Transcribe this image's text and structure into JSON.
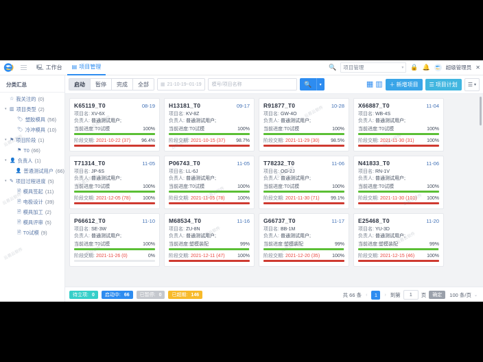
{
  "header": {
    "logo_icon": "brand-logo-icon",
    "menu_icon": "hamburger-icon",
    "tabs": [
      {
        "label": "工作台",
        "icon": "monitor-icon",
        "active": false
      },
      {
        "label": "项目管理",
        "icon": "grid-icon",
        "active": true
      }
    ],
    "search_icon": "search-icon",
    "module_select": "项目管理",
    "lock_icon": "lock-icon",
    "bell_icon": "bell-icon",
    "avatar_icon": "user-avatar",
    "username": "超级管理员",
    "close_icon": "close-icon"
  },
  "sidebar": {
    "title": "分类汇总",
    "items": [
      {
        "label": "我关注的",
        "count": "(0)",
        "icon": "star-icon",
        "level": 1,
        "caret": ""
      },
      {
        "label": "项目类型",
        "count": "(2)",
        "icon": "folder-icon",
        "level": 1,
        "caret": "▾"
      },
      {
        "label": "塑胶模具",
        "count": "(56)",
        "icon": "tag-icon",
        "level": 2,
        "caret": ""
      },
      {
        "label": "冷冲模具",
        "count": "(10)",
        "icon": "tag-icon",
        "level": 2,
        "caret": ""
      },
      {
        "label": "项目阶段",
        "count": "(1)",
        "icon": "flag-icon",
        "level": 1,
        "caret": "▾"
      },
      {
        "label": "T0",
        "count": "(66)",
        "icon": "flag-icon",
        "level": 2,
        "caret": ""
      },
      {
        "label": "负责人",
        "count": "(1)",
        "icon": "user-icon",
        "level": 1,
        "caret": "▾"
      },
      {
        "label": "普通测试用户",
        "count": "(66)",
        "icon": "user-icon",
        "level": 2,
        "caret": ""
      },
      {
        "label": "项目过程进度",
        "count": "(5)",
        "icon": "process-icon",
        "level": 1,
        "caret": "▾"
      },
      {
        "label": "模具签起",
        "count": "(11)",
        "icon": "file-icon",
        "level": 2,
        "caret": ""
      },
      {
        "label": "电极设计",
        "count": "(39)",
        "icon": "file-icon",
        "level": 2,
        "caret": ""
      },
      {
        "label": "模具加工",
        "count": "(2)",
        "icon": "file-icon",
        "level": 2,
        "caret": ""
      },
      {
        "label": "模具评审",
        "count": "(5)",
        "icon": "file-icon",
        "level": 2,
        "caret": ""
      },
      {
        "label": "T0试模",
        "count": "(9)",
        "icon": "file-icon",
        "level": 2,
        "caret": ""
      }
    ]
  },
  "toolbar": {
    "segments": [
      {
        "label": "启动",
        "active": true
      },
      {
        "label": "暂停",
        "active": false
      },
      {
        "label": "完成",
        "active": false
      },
      {
        "label": "全部",
        "active": false
      }
    ],
    "date_icon": "calendar-icon",
    "date_range": "21-10-19~01-19",
    "keyword_placeholder": "模号/项目名称",
    "search_icon": "search-icon",
    "search_dropdown_icon": "chevron-down-icon",
    "view_grid_icon": "grid-view-icon",
    "view_list_icon": "list-view-icon",
    "add_project_label": "新增项目",
    "add_project_icon": "plus-icon",
    "plan_label": "项目计划",
    "plan_icon": "list-icon",
    "more_icon": "menu-lines-icon",
    "more_caret_icon": "chevron-down-icon"
  },
  "cards": [
    {
      "code": "K65119_T0",
      "date": "08-19",
      "name_key": "项目名:",
      "name": "XV-6X",
      "owner_key": "负责人:",
      "owner": "普通测试用户;",
      "progress_key": "当前进度:",
      "progress_stage": "T0试模",
      "progress_pct": "100%",
      "progress_val": 100,
      "due_key": "阶段交期:",
      "due_date": "2021-10-22 (37)",
      "due_pct": "96.4%",
      "due_val": 100
    },
    {
      "code": "H13181_T0",
      "date": "09-17",
      "name_key": "项目名:",
      "name": "KV-8Z",
      "owner_key": "负责人:",
      "owner": "普通测试用户;",
      "progress_key": "当前进度:",
      "progress_stage": "T0试模",
      "progress_pct": "100%",
      "progress_val": 100,
      "due_key": "阶段交期:",
      "due_date": "2021-10-15 (37)",
      "due_pct": "98.7%",
      "due_val": 100
    },
    {
      "code": "R91877_T0",
      "date": "10-28",
      "name_key": "项目名:",
      "name": "GW-4O",
      "owner_key": "负责人:",
      "owner": "普通测试用户;",
      "progress_key": "当前进度:",
      "progress_stage": "T0试模",
      "progress_pct": "100%",
      "progress_val": 100,
      "due_key": "阶段交期:",
      "due_date": "2021-11-29 (30)",
      "due_pct": "98.5%",
      "due_val": 100
    },
    {
      "code": "X66887_T0",
      "date": "11-04",
      "name_key": "项目名:",
      "name": "WB-4S",
      "owner_key": "负责人:",
      "owner": "普通测试用户;",
      "progress_key": "当前进度:",
      "progress_stage": "T0试模",
      "progress_pct": "100%",
      "progress_val": 100,
      "due_key": "阶段交期:",
      "due_date": "2021-11-30 (31)",
      "due_pct": "100%",
      "due_val": 100
    },
    {
      "code": "T71314_T0",
      "date": "11-05",
      "name_key": "项目名:",
      "name": "JP-6S",
      "owner_key": "负责人:",
      "owner": "普通测试用户;",
      "progress_key": "当前进度:",
      "progress_stage": "T0试模",
      "progress_pct": "100%",
      "progress_val": 100,
      "due_key": "阶段交期:",
      "due_date": "2021-12-05 (78)",
      "due_pct": "100%",
      "due_val": 100
    },
    {
      "code": "P06743_T0",
      "date": "11-05",
      "name_key": "项目名:",
      "name": "LL-6J",
      "owner_key": "负责人:",
      "owner": "普通测试用户;",
      "progress_key": "当前进度:",
      "progress_stage": "T0试模",
      "progress_pct": "100%",
      "progress_val": 100,
      "due_key": "阶段交期:",
      "due_date": "2021-11-05 (78)",
      "due_pct": "100%",
      "due_val": 100
    },
    {
      "code": "T78232_T0",
      "date": "11-06",
      "name_key": "项目名:",
      "name": "OG-2J",
      "owner_key": "负责人:",
      "owner": "普通测试用户;",
      "progress_key": "当前进度:",
      "progress_stage": "T0试模",
      "progress_pct": "100%",
      "progress_val": 100,
      "due_key": "阶段交期:",
      "due_date": "2021-11-30 (71)",
      "due_pct": "99.1%",
      "due_val": 100
    },
    {
      "code": "N41833_T0",
      "date": "11-06",
      "name_key": "项目名:",
      "name": "RN-1V",
      "owner_key": "负责人:",
      "owner": "普通测试用户;",
      "progress_key": "当前进度:",
      "progress_stage": "T0试模",
      "progress_pct": "100%",
      "progress_val": 100,
      "due_key": "阶段交期:",
      "due_date": "2021-11-30 (101)",
      "due_pct": "100%",
      "due_val": 100
    },
    {
      "code": "P66612_T0",
      "date": "11-10",
      "name_key": "项目名:",
      "name": "SE-3W",
      "owner_key": "负责人:",
      "owner": "普通测试用户;",
      "progress_key": "当前进度:",
      "progress_stage": "T0试模",
      "progress_pct": "100%",
      "progress_val": 100,
      "due_key": "阶段交期:",
      "due_date": "2021-11-26 (0)",
      "due_pct": "0%",
      "due_val": 0
    },
    {
      "code": "M68534_T0",
      "date": "11-16",
      "name_key": "项目名:",
      "name": "ZU-8N",
      "owner_key": "负责人:",
      "owner": "普通测试用户;",
      "progress_key": "当前进度:",
      "progress_stage": "塑模装配",
      "progress_pct": "99%",
      "progress_val": 99,
      "due_key": "阶段交期:",
      "due_date": "2021-12-11 (47)",
      "due_pct": "100%",
      "due_val": 100
    },
    {
      "code": "G66737_T0",
      "date": "11-17",
      "name_key": "项目名:",
      "name": "BB-1M",
      "owner_key": "负责人:",
      "owner": "普通测试用户;",
      "progress_key": "当前进度:",
      "progress_stage": "塑模装配",
      "progress_pct": "99%",
      "progress_val": 99,
      "due_key": "阶段交期:",
      "due_date": "2021-12-20 (35)",
      "due_pct": "100%",
      "due_val": 100
    },
    {
      "code": "E25468_T0",
      "date": "11-20",
      "name_key": "项目名:",
      "name": "YU-3D",
      "owner_key": "负责人:",
      "owner": "普通测试用户;",
      "progress_key": "当前进度:",
      "progress_stage": "塑模装配",
      "progress_pct": "99%",
      "progress_val": 99,
      "due_key": "阶段交期:",
      "due_date": "2021-12-15 (46)",
      "due_pct": "100%",
      "due_val": 100
    }
  ],
  "footer": {
    "chips": [
      {
        "label": "待立项:",
        "value": "0",
        "color": "#36cfc9"
      },
      {
        "label": "启动中:",
        "value": "66",
        "color": "#2d8cf0"
      },
      {
        "label": "已暂停:",
        "value": "0",
        "color": "#c5c8ce"
      },
      {
        "label": "已超期:",
        "value": "146",
        "color": "#f7ba2a"
      }
    ],
    "total": "共 66 条",
    "prev_icon": "chevron-left-icon",
    "next_icon": "chevron-right-icon",
    "current_page": "1",
    "goto_prefix": "到第",
    "goto_value": "1",
    "goto_suffix": "页",
    "confirm_label": "确定",
    "page_size": "100 条/页",
    "page_size_caret": "chevron-down-icon"
  },
  "watermark": "云易云软件"
}
